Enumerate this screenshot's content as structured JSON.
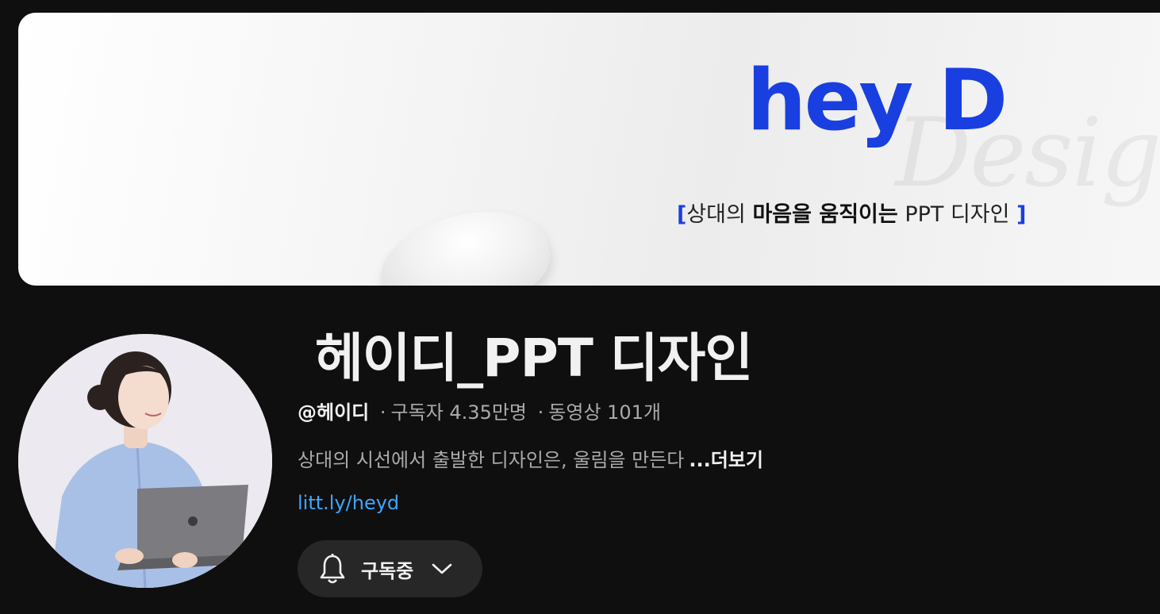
{
  "banner": {
    "logo_text": "hey D",
    "watermark_text": "Design",
    "tagline_open": "[",
    "tagline_part1": "상대의 ",
    "tagline_bold": "마음을 움직이는",
    "tagline_part2": " PPT 디자인 ",
    "tagline_close": "]",
    "accent_color": "#1a3fe0"
  },
  "channel": {
    "name": " 헤이디_PPT 디자인",
    "handle": "@헤이디",
    "subscribers": "구독자 4.35만명",
    "videos": "동영상 101개",
    "separator": "·",
    "description": "상대의 시선에서 출발한 디자인은, 울림을 만든다",
    "more_label": "...더보기",
    "link": "litt.ly/heyd",
    "link_color": "#3ea6ff"
  },
  "subscribe": {
    "label": "구독중",
    "bell_icon": "bell-icon",
    "chevron_icon": "chevron-down-icon"
  }
}
